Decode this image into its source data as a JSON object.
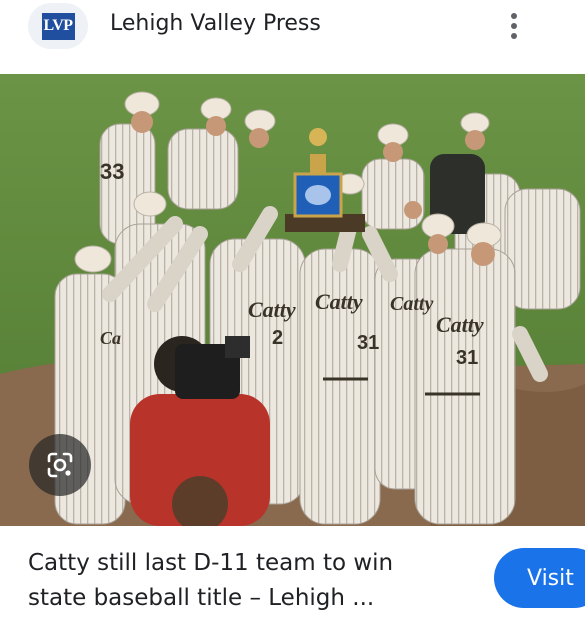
{
  "header": {
    "logo_text": "LVP",
    "site_name": "Lehigh Valley Press",
    "more_icon": "more-vert-icon"
  },
  "image": {
    "jersey_text": "Catty",
    "jersey_numbers": [
      "33",
      "2",
      "31",
      "31"
    ],
    "lens_icon": "google-lens-icon"
  },
  "result": {
    "title_line1": "Catty still last D-11 team to win",
    "title_line2": "state baseball title – Lehigh ...",
    "visit_label": "Visit"
  },
  "colors": {
    "brand_blue": "#1f4f9e",
    "visit_button": "#1a73e8",
    "grass": "#5f8a3c",
    "dirt": "#8a6a4e"
  }
}
